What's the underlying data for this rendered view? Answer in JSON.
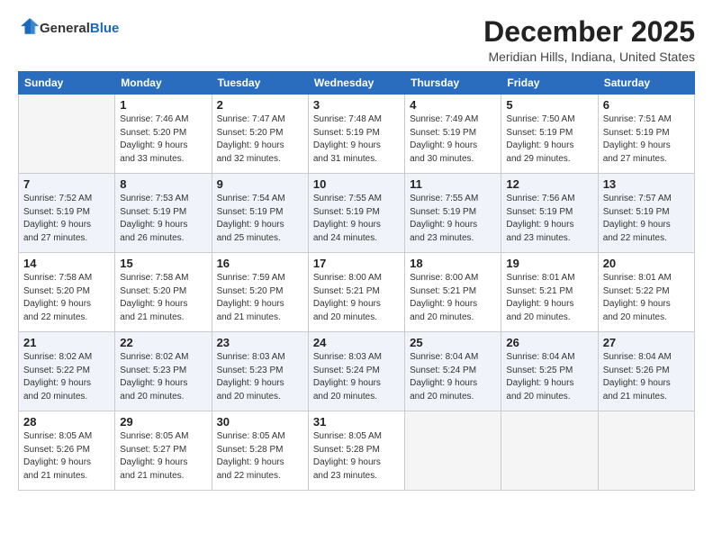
{
  "header": {
    "logo_general": "General",
    "logo_blue": "Blue",
    "month_title": "December 2025",
    "subtitle": "Meridian Hills, Indiana, United States"
  },
  "weekdays": [
    "Sunday",
    "Monday",
    "Tuesday",
    "Wednesday",
    "Thursday",
    "Friday",
    "Saturday"
  ],
  "weeks": [
    [
      {
        "day": "",
        "info": ""
      },
      {
        "day": "1",
        "info": "Sunrise: 7:46 AM\nSunset: 5:20 PM\nDaylight: 9 hours\nand 33 minutes."
      },
      {
        "day": "2",
        "info": "Sunrise: 7:47 AM\nSunset: 5:20 PM\nDaylight: 9 hours\nand 32 minutes."
      },
      {
        "day": "3",
        "info": "Sunrise: 7:48 AM\nSunset: 5:19 PM\nDaylight: 9 hours\nand 31 minutes."
      },
      {
        "day": "4",
        "info": "Sunrise: 7:49 AM\nSunset: 5:19 PM\nDaylight: 9 hours\nand 30 minutes."
      },
      {
        "day": "5",
        "info": "Sunrise: 7:50 AM\nSunset: 5:19 PM\nDaylight: 9 hours\nand 29 minutes."
      },
      {
        "day": "6",
        "info": "Sunrise: 7:51 AM\nSunset: 5:19 PM\nDaylight: 9 hours\nand 27 minutes."
      }
    ],
    [
      {
        "day": "7",
        "info": "Sunrise: 7:52 AM\nSunset: 5:19 PM\nDaylight: 9 hours\nand 27 minutes."
      },
      {
        "day": "8",
        "info": "Sunrise: 7:53 AM\nSunset: 5:19 PM\nDaylight: 9 hours\nand 26 minutes."
      },
      {
        "day": "9",
        "info": "Sunrise: 7:54 AM\nSunset: 5:19 PM\nDaylight: 9 hours\nand 25 minutes."
      },
      {
        "day": "10",
        "info": "Sunrise: 7:55 AM\nSunset: 5:19 PM\nDaylight: 9 hours\nand 24 minutes."
      },
      {
        "day": "11",
        "info": "Sunrise: 7:55 AM\nSunset: 5:19 PM\nDaylight: 9 hours\nand 23 minutes."
      },
      {
        "day": "12",
        "info": "Sunrise: 7:56 AM\nSunset: 5:19 PM\nDaylight: 9 hours\nand 23 minutes."
      },
      {
        "day": "13",
        "info": "Sunrise: 7:57 AM\nSunset: 5:19 PM\nDaylight: 9 hours\nand 22 minutes."
      }
    ],
    [
      {
        "day": "14",
        "info": "Sunrise: 7:58 AM\nSunset: 5:20 PM\nDaylight: 9 hours\nand 22 minutes."
      },
      {
        "day": "15",
        "info": "Sunrise: 7:58 AM\nSunset: 5:20 PM\nDaylight: 9 hours\nand 21 minutes."
      },
      {
        "day": "16",
        "info": "Sunrise: 7:59 AM\nSunset: 5:20 PM\nDaylight: 9 hours\nand 21 minutes."
      },
      {
        "day": "17",
        "info": "Sunrise: 8:00 AM\nSunset: 5:21 PM\nDaylight: 9 hours\nand 20 minutes."
      },
      {
        "day": "18",
        "info": "Sunrise: 8:00 AM\nSunset: 5:21 PM\nDaylight: 9 hours\nand 20 minutes."
      },
      {
        "day": "19",
        "info": "Sunrise: 8:01 AM\nSunset: 5:21 PM\nDaylight: 9 hours\nand 20 minutes."
      },
      {
        "day": "20",
        "info": "Sunrise: 8:01 AM\nSunset: 5:22 PM\nDaylight: 9 hours\nand 20 minutes."
      }
    ],
    [
      {
        "day": "21",
        "info": "Sunrise: 8:02 AM\nSunset: 5:22 PM\nDaylight: 9 hours\nand 20 minutes."
      },
      {
        "day": "22",
        "info": "Sunrise: 8:02 AM\nSunset: 5:23 PM\nDaylight: 9 hours\nand 20 minutes."
      },
      {
        "day": "23",
        "info": "Sunrise: 8:03 AM\nSunset: 5:23 PM\nDaylight: 9 hours\nand 20 minutes."
      },
      {
        "day": "24",
        "info": "Sunrise: 8:03 AM\nSunset: 5:24 PM\nDaylight: 9 hours\nand 20 minutes."
      },
      {
        "day": "25",
        "info": "Sunrise: 8:04 AM\nSunset: 5:24 PM\nDaylight: 9 hours\nand 20 minutes."
      },
      {
        "day": "26",
        "info": "Sunrise: 8:04 AM\nSunset: 5:25 PM\nDaylight: 9 hours\nand 20 minutes."
      },
      {
        "day": "27",
        "info": "Sunrise: 8:04 AM\nSunset: 5:26 PM\nDaylight: 9 hours\nand 21 minutes."
      }
    ],
    [
      {
        "day": "28",
        "info": "Sunrise: 8:05 AM\nSunset: 5:26 PM\nDaylight: 9 hours\nand 21 minutes."
      },
      {
        "day": "29",
        "info": "Sunrise: 8:05 AM\nSunset: 5:27 PM\nDaylight: 9 hours\nand 21 minutes."
      },
      {
        "day": "30",
        "info": "Sunrise: 8:05 AM\nSunset: 5:28 PM\nDaylight: 9 hours\nand 22 minutes."
      },
      {
        "day": "31",
        "info": "Sunrise: 8:05 AM\nSunset: 5:28 PM\nDaylight: 9 hours\nand 23 minutes."
      },
      {
        "day": "",
        "info": ""
      },
      {
        "day": "",
        "info": ""
      },
      {
        "day": "",
        "info": ""
      }
    ]
  ]
}
